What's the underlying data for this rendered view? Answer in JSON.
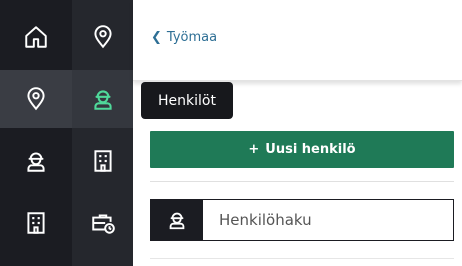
{
  "topbar": {
    "back_label": "Työmaa"
  },
  "tooltip": {
    "label": "Henkilöt"
  },
  "actions": {
    "new_person_label": "Uusi henkilö"
  },
  "search": {
    "placeholder": "Henkilöhaku"
  },
  "sidebar": {
    "primary": [
      "home-icon",
      "location-pin-icon",
      "worker-icon",
      "building-icon"
    ],
    "secondary": [
      "location-pin-icon",
      "worker-icon",
      "building-icon",
      "toolbox-clock-icon"
    ]
  },
  "colors": {
    "rail_dark": "#1b1c22",
    "rail_secondary": "#25272d",
    "accent_green": "#1f7a57",
    "active_icon": "#4fd99a",
    "link_blue": "#2e6f95"
  }
}
